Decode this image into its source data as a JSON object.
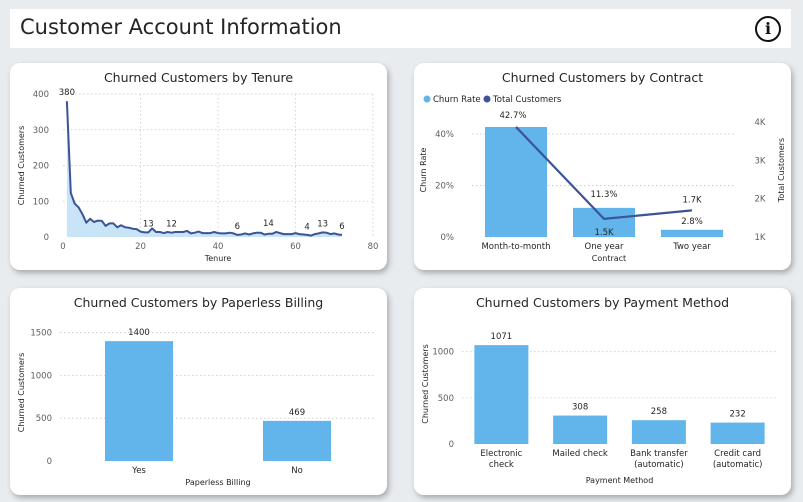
{
  "header": {
    "title": "Customer Account Information",
    "info_icon": "i"
  },
  "colors": {
    "bar": "#62b5ea",
    "line": "#3b5496",
    "area": "#c9e4f7",
    "grid": "#c8c8c8",
    "text": "#605e5c"
  },
  "chart_data": [
    {
      "id": "tenure",
      "type": "area",
      "title": "Churned Customers by Tenure",
      "xlabel": "Tenure",
      "ylabel": "Churned Customers",
      "xlim": [
        0,
        80
      ],
      "ylim": [
        0,
        400
      ],
      "xticks": [
        "0",
        "20",
        "40",
        "60",
        "80"
      ],
      "yticks": [
        "0",
        "100",
        "200",
        "300",
        "400"
      ],
      "x": [
        1,
        2,
        3,
        4,
        5,
        6,
        7,
        8,
        9,
        10,
        11,
        12,
        13,
        14,
        15,
        16,
        17,
        18,
        19,
        20,
        21,
        22,
        23,
        24,
        25,
        26,
        27,
        28,
        29,
        30,
        31,
        32,
        33,
        34,
        35,
        36,
        37,
        38,
        39,
        40,
        41,
        42,
        43,
        44,
        45,
        46,
        47,
        48,
        49,
        50,
        51,
        52,
        53,
        54,
        55,
        56,
        57,
        58,
        59,
        60,
        61,
        62,
        63,
        64,
        65,
        66,
        67,
        68,
        69,
        70,
        71,
        72
      ],
      "y": [
        380,
        123,
        94,
        83,
        64,
        40,
        51,
        42,
        46,
        45,
        31,
        38,
        38,
        27,
        33,
        27,
        26,
        23,
        22,
        15,
        13,
        13,
        24,
        14,
        14,
        11,
        14,
        12,
        14,
        14,
        14,
        17,
        10,
        12,
        15,
        11,
        11,
        11,
        14,
        11,
        10,
        10,
        12,
        10,
        6,
        7,
        10,
        7,
        10,
        12,
        12,
        7,
        9,
        9,
        14,
        11,
        8,
        8,
        8,
        11,
        8,
        7,
        6,
        4,
        8,
        10,
        13,
        12,
        8,
        10,
        7,
        6
      ],
      "data_labels": [
        {
          "x": 1,
          "y": 380,
          "text": "380"
        },
        {
          "x": 22,
          "y": 13,
          "text": "13"
        },
        {
          "x": 28,
          "y": 12,
          "text": "12"
        },
        {
          "x": 45,
          "y": 6,
          "text": "6"
        },
        {
          "x": 53,
          "y": 14,
          "text": "14"
        },
        {
          "x": 63,
          "y": 4,
          "text": "4"
        },
        {
          "x": 67,
          "y": 13,
          "text": "13"
        },
        {
          "x": 72,
          "y": 6,
          "text": "6"
        }
      ],
      "grid": true
    },
    {
      "id": "contract",
      "type": "bar",
      "title": "Churned Customers by Contract",
      "xlabel": "Contract",
      "ylabel": "Churn Rate",
      "y2label": "Total Customers",
      "legend_position": "top-left",
      "categories": [
        "Month-to-month",
        "One year",
        "Two year"
      ],
      "series": [
        {
          "name": "Churn Rate",
          "values": [
            42.7,
            11.3,
            2.8
          ],
          "labels": [
            "42.7%",
            "11.3%",
            "2.8%"
          ]
        },
        {
          "name": "Total Customers",
          "values": [
            3875,
            1473,
            1695
          ],
          "labels": [
            "",
            "1.5K",
            "1.7K"
          ]
        }
      ],
      "ylim": [
        0,
        52
      ],
      "yticks": [
        "0%",
        "20%",
        "40%"
      ],
      "y2lim": [
        1000,
        4500
      ],
      "y2ticks": [
        "1K",
        "2K",
        "3K",
        "4K"
      ],
      "grid": true
    },
    {
      "id": "paperless",
      "type": "bar",
      "title": "Churned Customers by Paperless Billing",
      "xlabel": "Paperless Billing",
      "ylabel": "Churned Customers",
      "categories": [
        "Yes",
        "No"
      ],
      "values": [
        1400,
        469
      ],
      "labels": [
        "1400",
        "469"
      ],
      "ylim": [
        0,
        1600
      ],
      "yticks": [
        "0",
        "500",
        "1000",
        "1500"
      ],
      "grid": true
    },
    {
      "id": "payment",
      "type": "bar",
      "title": "Churned Customers by Payment Method",
      "xlabel": "Payment Method",
      "ylabel": "Churned Customers",
      "categories": [
        "Electronic check",
        "Mailed check",
        "Bank transfer (automatic)",
        "Credit card (automatic)"
      ],
      "category_lines": [
        [
          "Electronic",
          "check"
        ],
        [
          "Mailed check"
        ],
        [
          "Bank transfer",
          "(automatic)"
        ],
        [
          "Credit card",
          "(automatic)"
        ]
      ],
      "values": [
        1071,
        308,
        258,
        232
      ],
      "labels": [
        "1071",
        "308",
        "258",
        "232"
      ],
      "ylim": [
        0,
        1300
      ],
      "yticks": [
        "0",
        "500",
        "1000"
      ],
      "grid": true
    }
  ]
}
